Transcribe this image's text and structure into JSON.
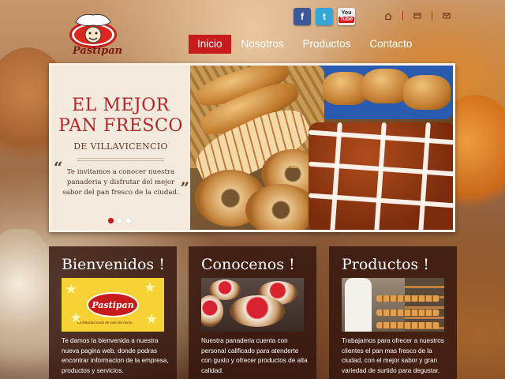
{
  "brand": {
    "name": "Pastipan"
  },
  "social": [
    {
      "id": "facebook",
      "label": "f"
    },
    {
      "id": "twitter",
      "label": "t"
    },
    {
      "id": "youtube",
      "label_top": "You",
      "label_bottom": "Tube"
    }
  ],
  "nav": {
    "items": [
      {
        "label": "Inicio",
        "active": true
      },
      {
        "label": "Nosotros"
      },
      {
        "label": "Productos"
      },
      {
        "label": "Contacto"
      }
    ]
  },
  "hero": {
    "title_line1": "EL MEJOR",
    "title_line2": "PAN FRESCO",
    "subtitle": "DE VILLAVICENCIO",
    "quote": "Te invitamos a conocer nuestra panaderia y disfrutar del mejor sabor del pan fresco de la ciudad.",
    "open_quote": "“",
    "close_quote": "”"
  },
  "panels": [
    {
      "title": "Bienvenidos !",
      "logo_text": "Pastipan",
      "tagline": "La felicidad nada de sale del horno",
      "text": "Te damos la bienvenida a nuestra nueva pagina web, donde podras encontrar informacion de la empresa, productos y servicios."
    },
    {
      "title": "Conocenos !",
      "text": "Nuestra panaderia cuenta con personal calificado para atenderte con gusto y ofrecer productos de alta calidad."
    },
    {
      "title": "Productos !",
      "text": "Trabajamos para ofrecer a nuestros clientes el pan mas fresco de la ciudad, con el mejor sabor y gran variedad de surtido para degustar."
    }
  ],
  "colors": {
    "accent": "#c81b1b",
    "title_red": "#b0262a",
    "panel_bg": "#32140e"
  }
}
